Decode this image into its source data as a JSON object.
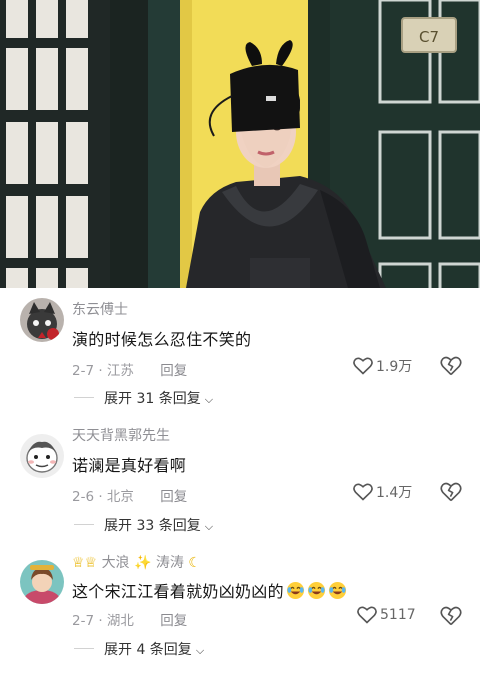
{
  "video": {
    "door_plate_text": "C7"
  },
  "comments": [
    {
      "username": "东云傅士",
      "badge": "",
      "text": "演的时候怎么忍住不笑的",
      "emoji_count": 0,
      "date_location": "2-7 · 江苏",
      "reply_label": "回复",
      "likes": "1.9万",
      "expand_label": "展开 31 条回复"
    },
    {
      "username": "天天背黑郭先生",
      "badge": "",
      "text": "诺澜是真好看啊",
      "emoji_count": 0,
      "date_location": "2-6 · 北京",
      "reply_label": "回复",
      "likes": "1.4万",
      "expand_label": "展开 33 条回复"
    },
    {
      "username": "大浪",
      "name_suffix": "涛涛",
      "text": "这个宋江江看着就奶凶奶凶的",
      "emoji_count": 3,
      "date_location": "2-7 · 湖北",
      "reply_label": "回复",
      "likes": "5117",
      "expand_label": "展开 4 条回复"
    }
  ],
  "icons": {
    "like": "heart-outline-icon",
    "dislike": "broken-heart-icon",
    "expand": "chevron-down-icon",
    "emoji": "laughing-tears-emoji-icon"
  },
  "colors": {
    "username": "#8f8f94",
    "text": "#161616",
    "meta": "#9a9a9f",
    "crown": "#e8b300"
  }
}
